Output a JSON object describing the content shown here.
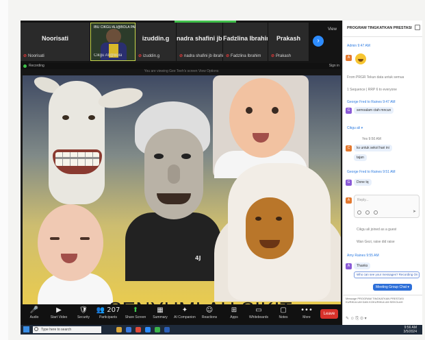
{
  "participants": [
    {
      "name": "Noorisati",
      "sub": "Noorisati"
    },
    {
      "name": "",
      "sub": "Cikgu Ali@Bola",
      "video_title": "IBU CIKGU ALI@BOLA PADANG"
    },
    {
      "name": "izuddin.g",
      "sub": "izuddin.g"
    },
    {
      "name": "nadra shafini jb...",
      "sub": "nadra shafini jb ibrahim"
    },
    {
      "name": "Fadzlina Ibrahim",
      "sub": "Fadzlina Ibrahim"
    },
    {
      "name": "Prakash",
      "sub": "Prakash"
    }
  ],
  "top": {
    "view_label": "View",
    "recording_label": "Recording",
    "sign_in_label": "Sign in",
    "share_label": "You are viewing Gee Teeh's screen  View Options"
  },
  "slide": {
    "caption": "SENYUMLAH SIKIT",
    "watermark": "4J"
  },
  "toolbar": [
    {
      "icon": "🎤",
      "label": "Audio",
      "green": false
    },
    {
      "icon": "▶",
      "label": "Start Video",
      "green": false
    },
    {
      "icon": "🛡",
      "label": "Security",
      "green": false
    },
    {
      "icon": "👥 207",
      "label": "Participants",
      "green": false
    },
    {
      "icon": "⬆",
      "label": "Share Screen",
      "green": true
    },
    {
      "icon": "▦",
      "label": "Summary",
      "green": false
    },
    {
      "icon": "✦",
      "label": "AI Companion",
      "green": false
    },
    {
      "icon": "☺",
      "label": "Reactions",
      "green": false
    },
    {
      "icon": "⊞",
      "label": "Apps",
      "green": false
    },
    {
      "icon": "▭",
      "label": "Whiteboards",
      "green": false
    },
    {
      "icon": "▢",
      "label": "Notes",
      "green": false
    },
    {
      "icon": "•••",
      "label": "More",
      "green": false
    }
  ],
  "leave_label": "Leave",
  "taskbar": {
    "search_placeholder": "Type here to search",
    "time": "9:56 AM",
    "date": "3/5/2024"
  },
  "chat": {
    "title": "PROGRAM TINGKATKAN PRESTASI K...",
    "messages": [
      {
        "kind": "sender",
        "text": "Admin  9:47 AM"
      },
      {
        "kind": "meta",
        "text": "From PRGR Tekun data untuk semua"
      },
      {
        "kind": "meta",
        "text": "1 Sequence | RRP 6 to everyone"
      },
      {
        "kind": "sender",
        "text": "George Fred to Raines  9:47 AM"
      },
      {
        "kind": "bubble",
        "text": "semoalam ctah mncun"
      },
      {
        "kind": "sender",
        "text": "Cikgu ali  ▾"
      },
      {
        "kind": "meta",
        "text": "Yes  9:50 AM"
      },
      {
        "kind": "bubble",
        "text": "ks untuk sekol hari ini"
      },
      {
        "kind": "bubble",
        "text": "tajan"
      },
      {
        "kind": "sender",
        "text": "George Fred to Raines  9:51 AM"
      },
      {
        "kind": "bubble",
        "text": "Done tq"
      },
      {
        "kind": "meta",
        "text": "Cikgu ali joined as a guest"
      },
      {
        "kind": "meta",
        "text": "Wan Gezi, raise did raise"
      },
      {
        "kind": "sender",
        "text": "Amy Raines  9:55 AM"
      },
      {
        "kind": "bubble",
        "text": "Thanks"
      }
    ],
    "reply_placeholder": "Reply...",
    "link_text": "Who can see your messages? Recording On",
    "meeting_chip": "Meeting Group Chat ▾",
    "input_to": "Message PROGRAM TINGKATKAN PRESTASI KURIKULUM DAN KOKURIKULUM SEKOLAH"
  }
}
